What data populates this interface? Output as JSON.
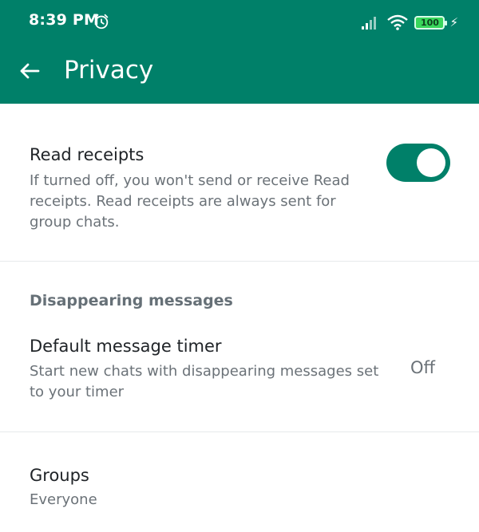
{
  "status_bar": {
    "time": "8:39 PM",
    "battery": "100",
    "icons": [
      "alarm-icon",
      "signal-icon",
      "wifi-icon",
      "battery-icon",
      "charging-icon"
    ],
    "color": "#008069"
  },
  "app_bar": {
    "title": "Privacy",
    "back_icon": "arrow-left-icon",
    "color": "#008069"
  },
  "settings": {
    "read_receipts": {
      "title": "Read receipts",
      "description": "If turned off, you won't send or receive Read receipts. Read receipts are always sent for group chats.",
      "enabled": true
    },
    "disappearing": {
      "header": "Disappearing messages",
      "default_timer": {
        "title": "Default message timer",
        "description": "Start new chats with disappearing messages set to your timer",
        "value": "Off"
      }
    },
    "groups": {
      "title": "Groups",
      "value": "Everyone"
    }
  }
}
